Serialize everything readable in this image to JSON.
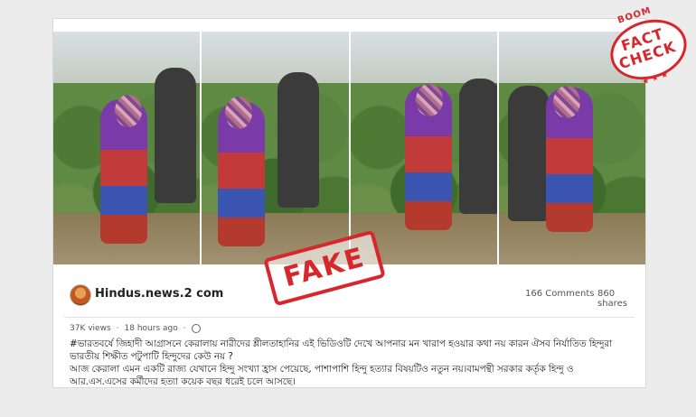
{
  "page": {
    "name": "Hindus.news.2 com",
    "comments": "166 Comments",
    "shares": "860 shares"
  },
  "meta": {
    "views": "37K views",
    "time": "18 hours ago"
  },
  "post_lines": [
    "#ভারতবর্ষে জিহাদী আগ্রাসনে কেরালায় নারীদের শ্লীলতাহানির এই ভিডিওটি দেখে আপনার মন খারাপ হওয়ার কথা নয় কারন ঐসব নির্যাতিত হিন্দুরা",
    "ভারতীয় শিক্ষীত পটুপাটি হিন্দুদের কেউ নয় ?",
    "আজ কেরালা এমন একটি রাজ্য যেখানে হিন্দু সংখ্যা হ্রাস পেয়েছে, পাশাপাশি হিন্দু হত্যার বিষয়টিও নতুন নয়।বামপন্থী সরকার কর্তৃক হিন্দু ও",
    "আর.এস.এসের কর্মীদের হত্যা কয়েক বছর ধরেই চলে আসছে।"
  ],
  "fake_stamp": "FAKE",
  "fact_check": {
    "top": "BOOM",
    "line1": "FACT",
    "line2": "CHECK",
    "stars": "★ ★ ★"
  },
  "icons": {
    "avatar": "page-avatar",
    "privacy": "globe-icon"
  }
}
